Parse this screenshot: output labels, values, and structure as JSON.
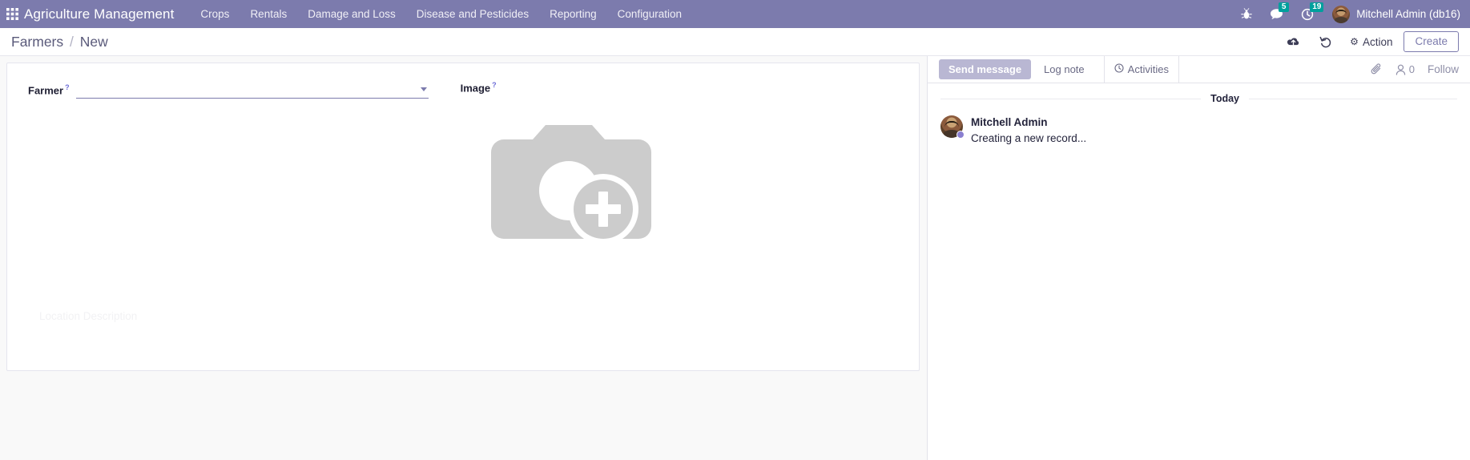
{
  "navbar": {
    "apps_icon": "apps-grid-icon",
    "brand": "Agriculture Management",
    "menu": [
      {
        "label": "Crops"
      },
      {
        "label": "Rentals"
      },
      {
        "label": "Damage and Loss"
      },
      {
        "label": "Disease and Pesticides"
      },
      {
        "label": "Reporting"
      },
      {
        "label": "Configuration"
      }
    ],
    "right": {
      "debug_icon": "bug-icon",
      "messages_icon": "speech-bubble-icon",
      "messages_count": "5",
      "activities_icon": "clock-icon",
      "activities_count": "19",
      "avatar": "user-avatar",
      "user_name": "Mitchell Admin (db16)"
    },
    "accent_color": "#7c7bad",
    "badge_color": "#00a09d"
  },
  "control_panel": {
    "breadcrumb": {
      "root": "Farmers",
      "separator": "/",
      "current": "New"
    },
    "save_icon": "cloud-upload-icon",
    "discard_icon": "undo-icon",
    "action_icon": "gear-icon",
    "action_label": "Action",
    "create_label": "Create"
  },
  "form": {
    "farmer": {
      "label": "Farmer",
      "tooltip_marker": "?",
      "value": "",
      "placeholder": "",
      "dropdown_icon": "chevron-down-icon"
    },
    "image": {
      "label": "Image",
      "tooltip_marker": "?",
      "placeholder_icon": "camera-add-icon"
    },
    "location_description_placeholder": "Location Description"
  },
  "chatter": {
    "send_message_label": "Send message",
    "log_note_label": "Log note",
    "activities_label": "Activities",
    "activities_icon": "clock-icon",
    "attachment_icon": "paperclip-icon",
    "followers_icon": "user-icon",
    "followers_count": "0",
    "follow_label": "Follow",
    "thread": {
      "day_label": "Today",
      "messages": [
        {
          "author": "Mitchell Admin",
          "body": "Creating a new record...",
          "avatar": "user-avatar",
          "status_dot_color": "#8a7fd0"
        }
      ]
    }
  }
}
